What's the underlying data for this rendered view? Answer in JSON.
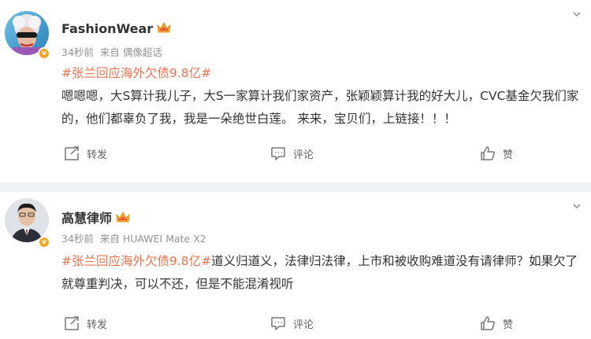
{
  "posts": [
    {
      "username": "FashionWear",
      "time": "34秒前",
      "source": "来自 偶像超话",
      "hashtag": "#张兰回应海外欠债9.8亿#",
      "text": "嗯嗯嗯，大S算计我儿子，大S一家算计我们家资产，张颖颖算计我的好大儿，CVC基金欠我们家的，他们都辜负了我，我是一朵绝世白莲。 来来，宝贝们，上链接！！！",
      "actions": {
        "repost": "转发",
        "comment": "评论",
        "like": "赞"
      }
    },
    {
      "username": "高慧律师",
      "time": "34秒前",
      "source": "来自 HUAWEI Mate X2",
      "hashtag": "#张兰回应海外欠债9.8亿#",
      "text": "道义归道义，法律归法律，上市和被收购难道没有请律师？如果欠了就尊重判决，可以不还，但是不能混淆视听",
      "actions": {
        "repost": "转发",
        "comment": "评论",
        "like": "赞"
      }
    }
  ],
  "colors": {
    "hashtag": "#eb7350",
    "verified_badge": "#f5a623",
    "meta": "#939393",
    "separator": "#f1f2f5"
  },
  "icons": [
    "avatar",
    "verified-badge-icon",
    "crown-icon",
    "chevron-down-icon",
    "repost-icon",
    "comment-icon",
    "like-icon"
  ]
}
